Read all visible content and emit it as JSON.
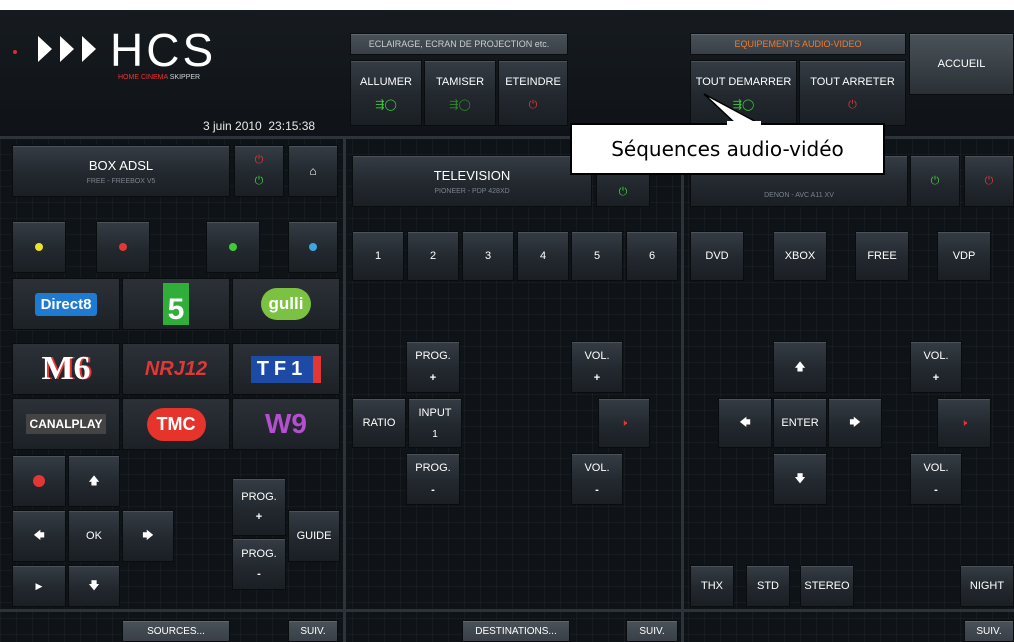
{
  "colors": {
    "accent_orange": "#f07a2c",
    "power_on": "#3ecb3a",
    "power_off": "#e33636",
    "text_dim": "#7b838b"
  },
  "brand": {
    "name": "HCS",
    "tagline_prefix": "HOME CINEMA",
    "tagline_suffix": "SKIPPER"
  },
  "datetime": "3 juin 2010  23:15:38",
  "header": {
    "lighting": {
      "title": "ECLAIRAGE, ECRAN DE PROJECTION etc.",
      "on": "ALLUMER",
      "dim": "TAMISER",
      "off": "ETEINDRE"
    },
    "av": {
      "title": "EQUIPEMENTS AUDIO-VIDEO",
      "start_all": "TOUT DEMARRER",
      "stop_all": "TOUT ARRETER"
    },
    "home": "ACCUEIL"
  },
  "callout": "Séquences audio-vidéo",
  "box": {
    "name": "BOX ADSL",
    "model": "FREE - FREEBOX V5",
    "channels": [
      [
        "Direct8",
        "5",
        "gulli"
      ],
      [
        "M6",
        "NRJ12",
        "TF1"
      ],
      [
        "CANALPLAY",
        "TMC",
        "W9"
      ]
    ],
    "ok": "OK",
    "prog": "PROG.",
    "plus": "+",
    "minus": "-",
    "guide": "GUIDE"
  },
  "tv": {
    "name": "TELEVISION",
    "model": "PIONEER - PDP 428XD",
    "inputs": [
      "1",
      "2",
      "3",
      "4",
      "5",
      "6"
    ],
    "prog": "PROG.",
    "vol": "VOL.",
    "ratio": "RATIO",
    "input": "INPUT",
    "input_num": "1",
    "plus": "+",
    "minus": "-"
  },
  "amp": {
    "model": "DENON - AVC A11 XV",
    "sources": [
      "DVD",
      "XBOX",
      "FREE",
      "VDP"
    ],
    "enter": "ENTER",
    "vol": "VOL.",
    "plus": "+",
    "minus": "-",
    "modes": [
      "THX",
      "STD",
      "STEREO"
    ],
    "night": "NIGHT"
  },
  "footer": {
    "sources": "SOURCES...",
    "destinations": "DESTINATIONS...",
    "next": "SUIV."
  }
}
